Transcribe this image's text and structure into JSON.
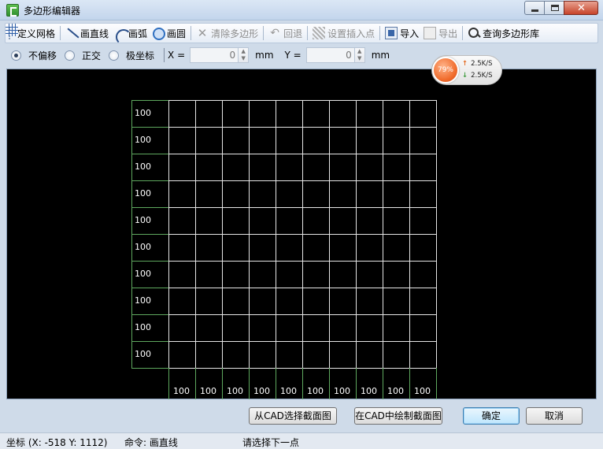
{
  "window": {
    "title": "多边形编辑器"
  },
  "toolbar": {
    "define_grid": "定义网格",
    "draw_line": "画直线",
    "draw_arc": "画弧",
    "draw_circle": "画圆",
    "clear_polygon": "清除多边形",
    "undo": "回退",
    "set_insert_point": "设置插入点",
    "import": "导入",
    "export": "导出",
    "query_library": "查询多边形库"
  },
  "modes": {
    "no_offset": "不偏移",
    "orthogonal": "正交",
    "polar": "极坐标",
    "selected": "no_offset"
  },
  "coords": {
    "x_label": "X =",
    "x_value": "0",
    "x_unit": "mm",
    "y_label": "Y =",
    "y_value": "0",
    "y_unit": "mm"
  },
  "grid": {
    "rows": 10,
    "cols": 10,
    "row_labels": [
      "100",
      "100",
      "100",
      "100",
      "100",
      "100",
      "100",
      "100",
      "100",
      "100"
    ],
    "col_labels": [
      "100",
      "100",
      "100",
      "100",
      "100",
      "100",
      "100",
      "100",
      "100",
      "100"
    ]
  },
  "network_widget": {
    "percent": "79%",
    "upload": "2.5K/S",
    "download": "2.5K/S"
  },
  "buttons": {
    "select_from_cad": "从CAD选择截面图",
    "draw_in_cad": "在CAD中绘制截面图",
    "ok": "确定",
    "cancel": "取消"
  },
  "status": {
    "coords": "坐标 (X: -518 Y: 1112)",
    "command": "命令: 画直线",
    "prompt": "请选择下一点"
  }
}
